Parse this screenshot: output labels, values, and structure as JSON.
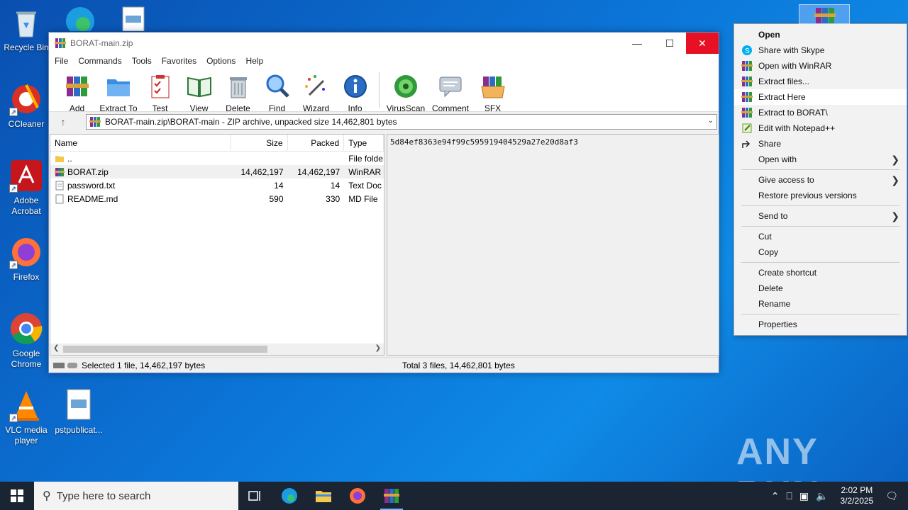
{
  "desktop": {
    "icons": [
      {
        "label": "Recycle Bin"
      },
      {
        "label": "CCleaner"
      },
      {
        "label": "Adobe Acrobat"
      },
      {
        "label": "Firefox"
      },
      {
        "label": "Google Chrome"
      },
      {
        "label": "VLC media player"
      },
      {
        "label": "pstpublicat..."
      }
    ]
  },
  "window": {
    "title": "BORAT-main.zip",
    "menu": [
      "File",
      "Commands",
      "Tools",
      "Favorites",
      "Options",
      "Help"
    ],
    "toolbar": [
      "Add",
      "Extract To",
      "Test",
      "View",
      "Delete",
      "Find",
      "Wizard",
      "Info",
      "VirusScan",
      "Comment",
      "SFX"
    ],
    "address": "BORAT-main.zip\\BORAT-main - ZIP archive, unpacked size 14,462,801 bytes",
    "columns": {
      "name": "Name",
      "size": "Size",
      "packed": "Packed",
      "type": "Type"
    },
    "files": [
      {
        "name": "..",
        "size": "",
        "packed": "",
        "type": "File folde"
      },
      {
        "name": "BORAT.zip",
        "size": "14,462,197",
        "packed": "14,462,197",
        "type": "WinRAR"
      },
      {
        "name": "password.txt",
        "size": "14",
        "packed": "14",
        "type": "Text Doc"
      },
      {
        "name": "README.md",
        "size": "590",
        "packed": "330",
        "type": "MD File"
      }
    ],
    "preview_text": "5d84ef8363e94f99c595919404529a27e20d8af3",
    "status_left": "Selected 1 file, 14,462,197 bytes",
    "status_right": "Total 3 files, 14,462,801 bytes"
  },
  "context_menu": {
    "items": [
      {
        "label": "Open"
      },
      {
        "label": "Share with Skype"
      },
      {
        "label": "Open with WinRAR"
      },
      {
        "label": "Extract files..."
      },
      {
        "label": "Extract Here"
      },
      {
        "label": "Extract to BORAT\\"
      },
      {
        "label": "Edit with Notepad++"
      },
      {
        "label": "Share"
      },
      {
        "label": "Open with"
      },
      {
        "label": "Give access to"
      },
      {
        "label": "Restore previous versions"
      },
      {
        "label": "Send to"
      },
      {
        "label": "Cut"
      },
      {
        "label": "Copy"
      },
      {
        "label": "Create shortcut"
      },
      {
        "label": "Delete"
      },
      {
        "label": "Rename"
      },
      {
        "label": "Properties"
      }
    ]
  },
  "taskbar": {
    "search_placeholder": "Type here to search",
    "time": "2:02 PM",
    "date": "3/2/2025"
  },
  "watermark": "ANY RUN"
}
